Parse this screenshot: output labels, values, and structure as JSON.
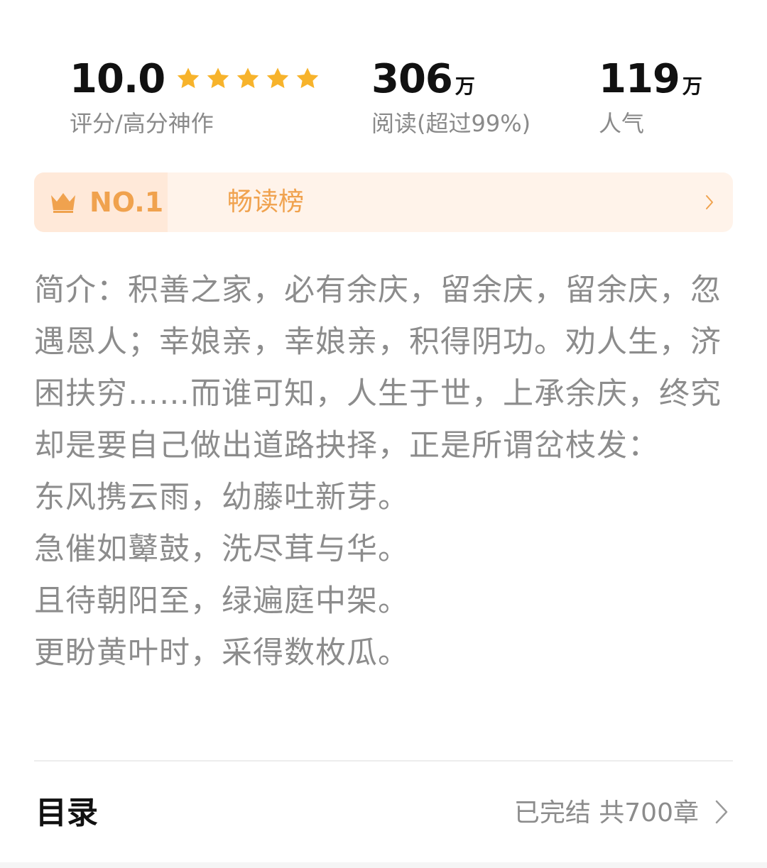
{
  "stats": {
    "rating": {
      "value": "10.0",
      "stars": 5,
      "label": "评分/高分神作"
    },
    "reads": {
      "value": "306",
      "unit": "万",
      "label": "阅读(超过99%)"
    },
    "popularity": {
      "value": "119",
      "unit": "万",
      "label": "人气"
    }
  },
  "rank": {
    "icon": "crown-icon",
    "number": "NO.1",
    "name": "畅读榜"
  },
  "intro": {
    "paragraph": "简介：积善之家，必有余庆，留余庆，留余庆，忽遇恩人；幸娘亲，幸娘亲，积得阴功。劝人生，济困扶穷……而谁可知，人生于世，上承余庆，终究却是要自己做出道路抉择，正是所谓岔枝发：",
    "lines": [
      "东风携云雨，幼藤吐新芽。",
      "急催如鼙鼓，洗尽茸与华。",
      "且待朝阳至，绿遍庭中架。",
      "更盼黄叶时，采得数枚瓜。"
    ]
  },
  "toc": {
    "title": "目录",
    "status": "已完结 共700章"
  },
  "colors": {
    "star": "#f7b32b",
    "rank_accent": "#f0a24e",
    "rank_bg": "#fff3ea",
    "muted_text": "#8c8c8c"
  }
}
